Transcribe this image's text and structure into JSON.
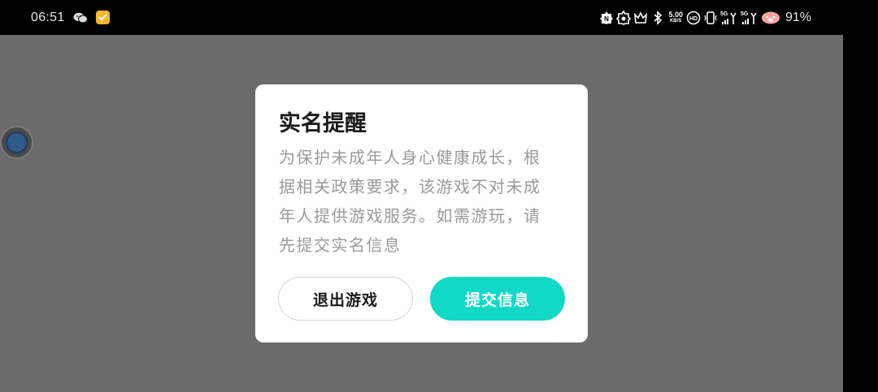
{
  "status_bar": {
    "time": "06:51",
    "left_icons": [
      "wechat-icon",
      "app-notification-icon"
    ],
    "right_icons": [
      "notification-icon",
      "notification-icon",
      "crown-icon",
      "bluetooth-icon",
      "hd-icon",
      "vibrate-icon"
    ],
    "net_speed_value": "5.00",
    "net_speed_unit": "KB/S",
    "signal_1_label": "5G",
    "signal_2_label": "5G",
    "battery_percent": "91%",
    "accent_color": "#f5b82e"
  },
  "dialog": {
    "title": "实名提醒",
    "body": "为保护未成年人身心健康成长，根据相关政策要求，该游戏不对未成年人提供游戏服务。如需游玩，请先提交实名信息",
    "exit_button_label": "退出游戏",
    "submit_button_label": "提交信息",
    "submit_color": "#10d9c5"
  },
  "colors": {
    "overlay": "#6b6b6b",
    "dialog_bg": "#ffffff",
    "body_text": "#9a9a9a"
  }
}
